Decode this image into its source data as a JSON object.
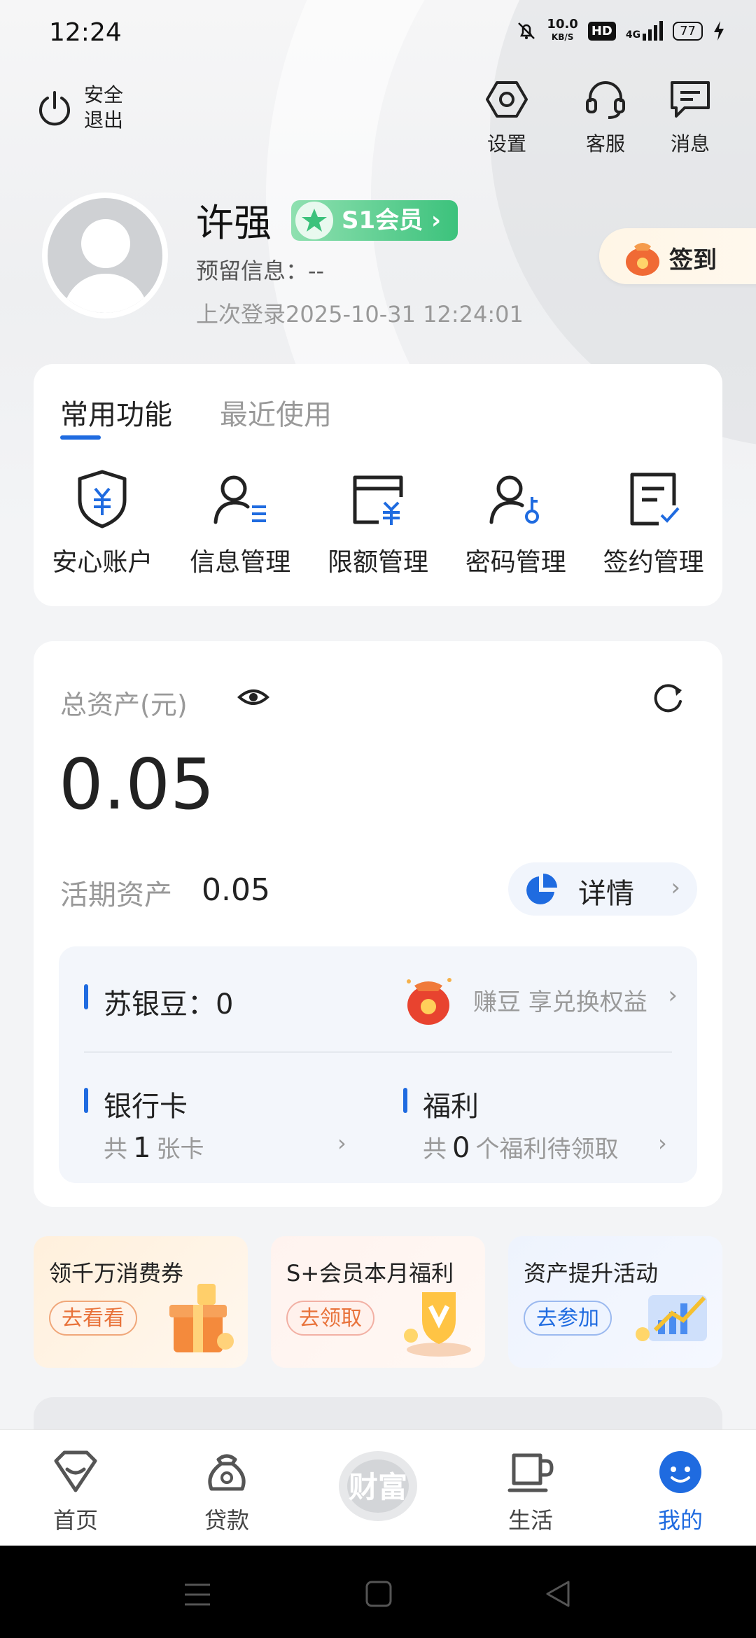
{
  "status_bar": {
    "time": "12:24",
    "speed_top": "10.0",
    "speed_bottom": "KB/S",
    "hd": "HD",
    "network": "4G",
    "battery": "77"
  },
  "header": {
    "logout": {
      "line1": "安全",
      "line2": "退出"
    },
    "settings_label": "设置",
    "service_label": "客服",
    "messages_label": "消息"
  },
  "profile": {
    "name": "许强",
    "member_badge": "S1会员",
    "reserved_info": "预留信息：--",
    "last_login": "上次登录2025-10-31 12:24:01",
    "signin_label": "签到"
  },
  "functions": {
    "tabs": [
      {
        "label": "常用功能"
      },
      {
        "label": "最近使用"
      }
    ],
    "items": [
      {
        "label": "安心账户",
        "icon": "shield-yuan-icon"
      },
      {
        "label": "信息管理",
        "icon": "user-list-icon"
      },
      {
        "label": "限额管理",
        "icon": "card-yuan-icon"
      },
      {
        "label": "密码管理",
        "icon": "user-key-icon"
      },
      {
        "label": "签约管理",
        "icon": "document-check-icon"
      }
    ]
  },
  "assets": {
    "title": "总资产(元)",
    "total": "0.05",
    "current_label": "活期资产",
    "current_value": "0.05",
    "detail_label": "详情",
    "beans_label": "苏银豆：",
    "beans_value": "0",
    "earn_label": "赚豆 享兑换权益",
    "bank_card": {
      "title": "银行卡",
      "prefix": "共",
      "count": "1",
      "suffix": "张卡"
    },
    "welfare": {
      "title": "福利",
      "prefix": "共",
      "count": "0",
      "suffix": "个福利待领取"
    }
  },
  "promos": [
    {
      "title": "领千万消费券",
      "button": "去看看"
    },
    {
      "title": "S+会员本月福利",
      "button": "去领取"
    },
    {
      "title": "资产提升活动",
      "button": "去参加"
    }
  ],
  "tabbar": {
    "items": [
      {
        "label": "首页",
        "icon": "home-icon"
      },
      {
        "label": "贷款",
        "icon": "money-bag-icon"
      },
      {
        "label": "财富",
        "icon": "wealth-logo"
      },
      {
        "label": "生活",
        "icon": "cup-icon"
      },
      {
        "label": "我的",
        "icon": "smile-icon"
      }
    ],
    "active_index": 4
  },
  "colors": {
    "accent": "#1f6be0",
    "member_green": "#3cc27c",
    "promo_orange": "#e8723a"
  }
}
